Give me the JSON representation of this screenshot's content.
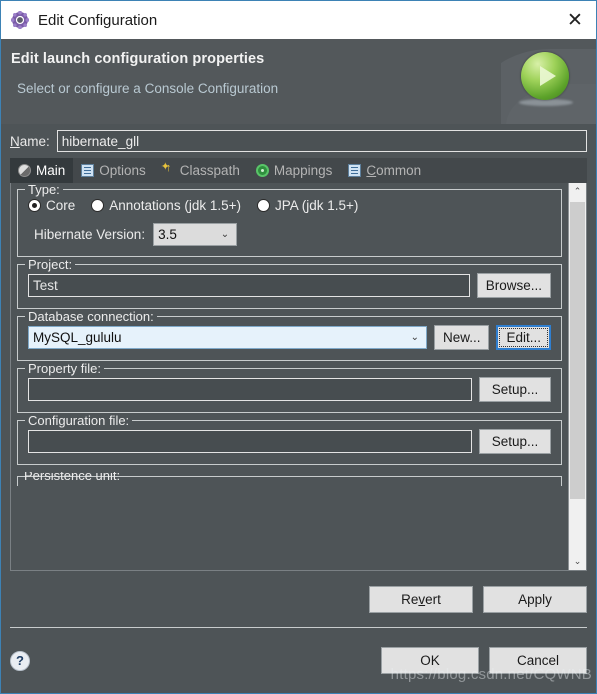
{
  "window": {
    "title": "Edit Configuration",
    "icon": "gear-icon",
    "close_label": "✕"
  },
  "header": {
    "title": "Edit launch configuration properties",
    "subtitle": "Select or configure a Console Configuration",
    "icon": "green-play-orb-icon"
  },
  "name_field": {
    "label_prefix": "N",
    "label_rest": "ame:",
    "value": "hibernate_gll"
  },
  "tabs": [
    {
      "label": "Main",
      "icon": "hibernate-icon",
      "active": true
    },
    {
      "label": "Options",
      "icon": "options-icon",
      "active": false
    },
    {
      "label": "Classpath",
      "icon": "classpath-icon",
      "active": false
    },
    {
      "label": "Mappings",
      "icon": "mappings-icon",
      "active": false
    },
    {
      "label": "Common",
      "icon": "common-icon",
      "active": false,
      "mnemonic": "C",
      "rest": "ommon"
    }
  ],
  "type_group": {
    "title": "Type:",
    "options": [
      {
        "label": "Core",
        "checked": true
      },
      {
        "label": "Annotations (jdk 1.5+)",
        "checked": false
      },
      {
        "label": "JPA (jdk 1.5+)",
        "checked": false
      }
    ],
    "version_label": "Hibernate Version:",
    "version_value": "3.5"
  },
  "project_group": {
    "title": "Project:",
    "value": "Test",
    "button": "Browse..."
  },
  "db_group": {
    "title": "Database connection:",
    "value": "MySQL_gululu",
    "new_button": "New...",
    "edit_button": "Edit..."
  },
  "property_group": {
    "title": "Property file:",
    "value": "",
    "button": "Setup..."
  },
  "config_group": {
    "title": "Configuration file:",
    "value": "",
    "button": "Setup..."
  },
  "cutoff_group": {
    "title": "Persistence unit:"
  },
  "footer": {
    "revert_mnemonic_pre": "Re",
    "revert_mnemonic": "v",
    "revert_mnemonic_post": "ert",
    "apply": "Apply",
    "ok": "OK",
    "cancel": "Cancel",
    "help_glyph": "?"
  },
  "watermark": "https://blog.csdn.net/CQWNB",
  "colors": {
    "dialog_bg": "#4e5457",
    "header_bg": "#53585b",
    "titlebar_bg": "#ffffff",
    "accent_border": "#3d82b5",
    "subtitle_text": "#b9c9d2",
    "combo_highlight": "#e6f2fb",
    "focus_blue": "#2f7fd0"
  }
}
